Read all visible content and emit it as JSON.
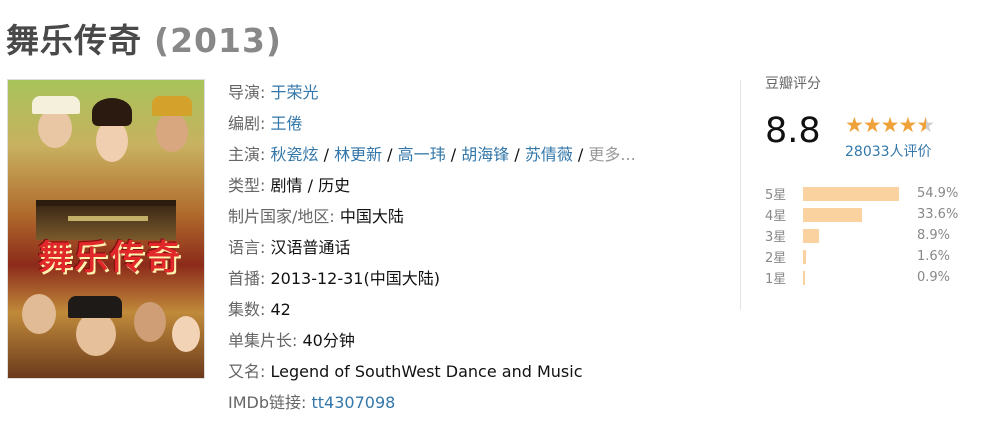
{
  "title": {
    "name": "舞乐传奇",
    "year": "(2013)"
  },
  "details": {
    "director_label": "导演:",
    "director": "于荣光",
    "writer_label": "编剧:",
    "writer": "王倦",
    "cast_label": "主演:",
    "cast": [
      "秋瓷炫",
      "林更新",
      "高一玮",
      "胡海锋",
      "苏倩薇"
    ],
    "cast_sep": " / ",
    "cast_more": "更多...",
    "genre_label": "类型:",
    "genre": "剧情 / 历史",
    "country_label": "制片国家/地区:",
    "country": "中国大陆",
    "language_label": "语言:",
    "language": "汉语普通话",
    "premiere_label": "首播:",
    "premiere": "2013-12-31(中国大陆)",
    "episodes_label": "集数:",
    "episodes": "42",
    "runtime_label": "单集片长:",
    "runtime": "40分钟",
    "aka_label": "又名:",
    "aka": "Legend of SouthWest Dance and Music",
    "imdb_label": "IMDb链接:",
    "imdb": "tt4307098"
  },
  "poster": {
    "title_text": "舞乐传奇"
  },
  "rating": {
    "header": "豆瓣评分",
    "score": "8.8",
    "stars": 4.5,
    "votes": "28033人评价",
    "color_fill": "#f9d2a0",
    "color_star": "#f0a23a",
    "distribution": [
      {
        "label": "5星",
        "pct": "54.9%",
        "value": 54.9
      },
      {
        "label": "4星",
        "pct": "33.6%",
        "value": 33.6
      },
      {
        "label": "3星",
        "pct": "8.9%",
        "value": 8.9
      },
      {
        "label": "2星",
        "pct": "1.6%",
        "value": 1.6
      },
      {
        "label": "1星",
        "pct": "0.9%",
        "value": 0.9
      }
    ]
  }
}
